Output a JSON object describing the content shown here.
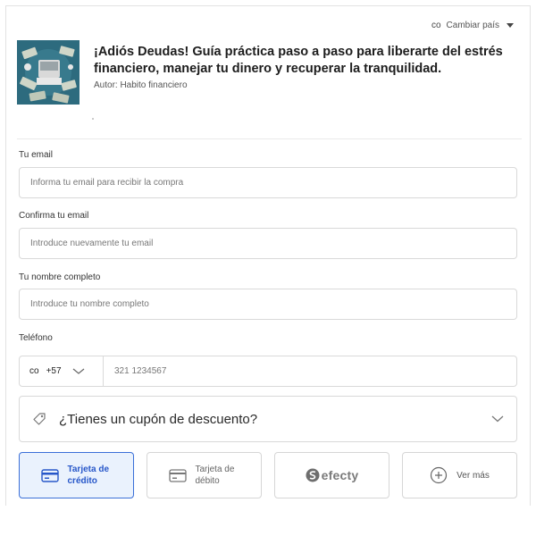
{
  "header": {
    "country_code": "co",
    "country_switch_label": "Cambiar país"
  },
  "product": {
    "title": "¡Adiós Deudas! Guía práctica paso a paso para liberarte del estrés financiero, manejar tu dinero y recuperar la tranquilidad.",
    "author": "Autor: Habito financiero"
  },
  "form": {
    "email": {
      "label": "Tu email",
      "placeholder": "Informa tu email para recibir la compra",
      "value": ""
    },
    "confirm_email": {
      "label": "Confirma tu email",
      "placeholder": "Introduce nuevamente tu email",
      "value": ""
    },
    "full_name": {
      "label": "Tu nombre completo",
      "placeholder": "Introduce tu nombre completo",
      "value": ""
    },
    "phone": {
      "label": "Teléfono",
      "country_code": "co",
      "dial_code": "+57",
      "placeholder": "321 1234567",
      "value": ""
    }
  },
  "coupon": {
    "label": "¿Tienes un cupón de descuento?"
  },
  "payment_methods": {
    "credit": {
      "label": "Tarjeta de crédito",
      "selected": true
    },
    "debit": {
      "label": "Tarjeta de débito",
      "selected": false
    },
    "efecty": {
      "label": "efecty",
      "selected": false
    },
    "more": {
      "label": "Ver más"
    }
  },
  "colors": {
    "accent": "#3a6fd8",
    "selected_bg": "#eaf2fd",
    "border": "#d9d9d9"
  },
  "icons": {
    "country_caret": "caret-down-icon",
    "coupon": "tag-icon",
    "coupon_chevron": "chevron-down-icon",
    "credit": "credit-card-icon",
    "debit": "debit-card-icon",
    "efecty_logo": "efecty-logo",
    "more": "plus-circle-icon"
  }
}
